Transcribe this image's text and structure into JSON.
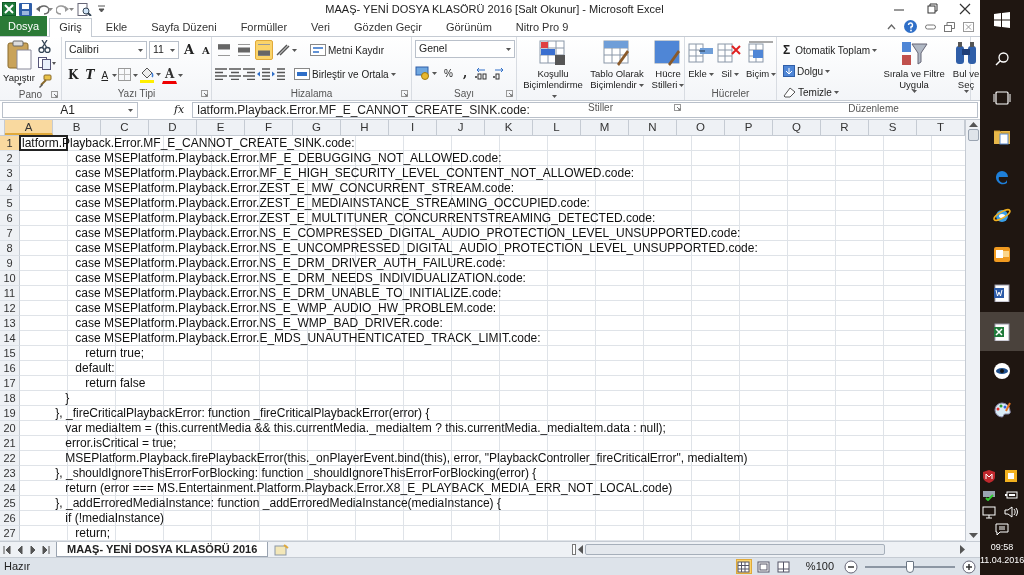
{
  "window": {
    "title": "MAAŞ- YENİ DOSYA KLASÖRÜ 2016  [Salt Okunur]  -  Microsoft Excel"
  },
  "ribbon_tabs": [
    {
      "label": "Dosya",
      "kind": "file",
      "selected": false
    },
    {
      "label": "Giriş",
      "kind": "tab",
      "selected": true
    },
    {
      "label": "Ekle",
      "kind": "tab",
      "selected": false
    },
    {
      "label": "Sayfa Düzeni",
      "kind": "tab",
      "selected": false
    },
    {
      "label": "Formüller",
      "kind": "tab",
      "selected": false
    },
    {
      "label": "Veri",
      "kind": "tab",
      "selected": false
    },
    {
      "label": "Gözden Geçir",
      "kind": "tab",
      "selected": false
    },
    {
      "label": "Görünüm",
      "kind": "tab",
      "selected": false
    },
    {
      "label": "Nitro Pro 9",
      "kind": "tab",
      "selected": false
    }
  ],
  "ribbon": {
    "clipboard": {
      "label": "Pano",
      "paste": "Yapıştır"
    },
    "font": {
      "label": "Yazı Tipi",
      "font_name": "Calibri",
      "font_size": "11",
      "grow": "A",
      "shrink": "A",
      "bold": "K",
      "italic": "T",
      "underline": "A",
      "font_color": "A"
    },
    "alignment": {
      "label": "Hizalama",
      "vertical": [
        {
          "selected": false
        },
        {
          "selected": false
        },
        {
          "selected": true
        }
      ],
      "wrap_text": "Metni Kaydır",
      "merge": "Birleştir ve Ortala"
    },
    "number": {
      "label": "Sayı",
      "format": "Genel",
      "percent": "%",
      "comma": ","
    },
    "styles": {
      "label": "Stiller",
      "conditional": "Koşullu Biçimlendirme",
      "as_table": "Tablo Olarak Biçimlendir",
      "cell_styles": "Hücre Stilleri"
    },
    "cells": {
      "label": "Hücreler",
      "insert": "Ekle",
      "delete": "Sil",
      "format": "Biçim"
    },
    "editing": {
      "label": "Düzenleme",
      "sum_symbol": "Σ",
      "autosum": "Otomatik Toplam",
      "fill": "Dolgu",
      "clear": "Temizle",
      "sort": "Sırala ve Filtre Uygula",
      "find": "Bul ve Seç"
    }
  },
  "formula_bar": {
    "name_box": "A1",
    "fx": "fx",
    "value": "latform.Playback.Error.MF_E_CANNOT_CREATE_SINK.code:"
  },
  "columns": [
    {
      "label": "A",
      "selected": true
    },
    {
      "label": "B",
      "selected": false
    },
    {
      "label": "C",
      "selected": false
    },
    {
      "label": "D",
      "selected": false
    },
    {
      "label": "E",
      "selected": false
    },
    {
      "label": "F",
      "selected": false
    },
    {
      "label": "G",
      "selected": false
    },
    {
      "label": "H",
      "selected": false
    },
    {
      "label": "I",
      "selected": false
    },
    {
      "label": "J",
      "selected": false
    },
    {
      "label": "K",
      "selected": false
    },
    {
      "label": "L",
      "selected": false
    },
    {
      "label": "M",
      "selected": false
    },
    {
      "label": "N",
      "selected": false
    },
    {
      "label": "O",
      "selected": false
    },
    {
      "label": "P",
      "selected": false
    },
    {
      "label": "Q",
      "selected": false
    },
    {
      "label": "R",
      "selected": false
    },
    {
      "label": "S",
      "selected": false
    },
    {
      "label": "T",
      "selected": false
    }
  ],
  "rows": [
    {
      "number": "1",
      "selected": true,
      "text": "latform.Playback.Error.MF_E_CANNOT_CREATE_SINK.code:"
    },
    {
      "number": "2",
      "selected": false,
      "text": "                case MSEPlatform.Playback.Error.MF_E_DEBUGGING_NOT_ALLOWED.code:"
    },
    {
      "number": "3",
      "selected": false,
      "text": "                case MSEPlatform.Playback.Error.MF_E_HIGH_SECURITY_LEVEL_CONTENT_NOT_ALLOWED.code:"
    },
    {
      "number": "4",
      "selected": false,
      "text": "                case MSEPlatform.Playback.Error.ZEST_E_MW_CONCURRENT_STREAM.code:"
    },
    {
      "number": "5",
      "selected": false,
      "text": "                case MSEPlatform.Playback.Error.ZEST_E_MEDIAINSTANCE_STREAMING_OCCUPIED.code:"
    },
    {
      "number": "6",
      "selected": false,
      "text": "                case MSEPlatform.Playback.Error.ZEST_E_MULTITUNER_CONCURRENTSTREAMING_DETECTED.code:"
    },
    {
      "number": "7",
      "selected": false,
      "text": "                case MSEPlatform.Playback.Error.NS_E_COMPRESSED_DIGITAL_AUDIO_PROTECTION_LEVEL_UNSUPPORTED.code:"
    },
    {
      "number": "8",
      "selected": false,
      "text": "                case MSEPlatform.Playback.Error.NS_E_UNCOMPRESSED_DIGITAL_AUDIO_PROTECTION_LEVEL_UNSUPPORTED.code:"
    },
    {
      "number": "9",
      "selected": false,
      "text": "                case MSEPlatform.Playback.Error.NS_E_DRM_DRIVER_AUTH_FAILURE.code:"
    },
    {
      "number": "10",
      "selected": false,
      "text": "                case MSEPlatform.Playback.Error.NS_E_DRM_NEEDS_INDIVIDUALIZATION.code:"
    },
    {
      "number": "11",
      "selected": false,
      "text": "                case MSEPlatform.Playback.Error.NS_E_DRM_UNABLE_TO_INITIALIZE.code:"
    },
    {
      "number": "12",
      "selected": false,
      "text": "                case MSEPlatform.Playback.Error.NS_E_WMP_AUDIO_HW_PROBLEM.code:"
    },
    {
      "number": "13",
      "selected": false,
      "text": "                case MSEPlatform.Playback.Error.NS_E_WMP_BAD_DRIVER.code:"
    },
    {
      "number": "14",
      "selected": false,
      "text": "                case MSEPlatform.Playback.Error.E_MDS_UNAUTHENTICATED_TRACK_LIMIT.code:"
    },
    {
      "number": "15",
      "selected": false,
      "text": "                   return true;"
    },
    {
      "number": "16",
      "selected": false,
      "text": "                default:"
    },
    {
      "number": "17",
      "selected": false,
      "text": "                   return false"
    },
    {
      "number": "18",
      "selected": false,
      "text": "             }"
    },
    {
      "number": "19",
      "selected": false,
      "text": "          }, _fireCriticalPlaybackError: function _fireCriticalPlaybackError(error) {"
    },
    {
      "number": "20",
      "selected": false,
      "text": "             var mediaItem = (this.currentMedia && this.currentMedia._mediaItem ? this.currentMedia._mediaItem.data : null);"
    },
    {
      "number": "21",
      "selected": false,
      "text": "             error.isCritical = true;"
    },
    {
      "number": "22",
      "selected": false,
      "text": "             MSEPlatform.Playback.firePlaybackError(this._onPlayerEvent.bind(this), error, \"PlaybackController_fireCriticalError\", mediaItem)"
    },
    {
      "number": "23",
      "selected": false,
      "text": "          }, _shouldIgnoreThisErrorForBlocking: function _shouldIgnoreThisErrorForBlocking(error) {"
    },
    {
      "number": "24",
      "selected": false,
      "text": "             return (error === MS.Entertainment.Platform.Playback.Error.X8_E_PLAYBACK_MEDIA_ERR_NOT_LOCAL.code)"
    },
    {
      "number": "25",
      "selected": false,
      "text": "          }, _addErroredMediaInstance: function _addErroredMediaInstance(mediaInstance) {"
    },
    {
      "number": "26",
      "selected": false,
      "text": "             if (!mediaInstance)"
    },
    {
      "number": "27",
      "selected": false,
      "text": "                return;"
    }
  ],
  "sheet_tabs": [
    {
      "label": "MAAŞ- YENİ DOSYA KLASÖRÜ 2016",
      "selected": true
    }
  ],
  "status_bar": {
    "status": "Hazır",
    "views": [
      {
        "selected": true
      },
      {
        "selected": false
      },
      {
        "selected": false
      }
    ],
    "zoom": "%100",
    "zoom_slider": {
      "level": 0.5
    }
  },
  "taskbar": {
    "apps": [
      {
        "kind": "explorer",
        "active": false
      },
      {
        "kind": "edge",
        "active": false
      },
      {
        "kind": "ie",
        "active": false
      },
      {
        "kind": "outlook",
        "active": false
      },
      {
        "kind": "word",
        "active": false
      },
      {
        "kind": "excel",
        "active": true
      },
      {
        "kind": "app",
        "active": false
      },
      {
        "kind": "paint",
        "active": false
      }
    ],
    "time": "09:58",
    "date": "11.04.2016"
  }
}
